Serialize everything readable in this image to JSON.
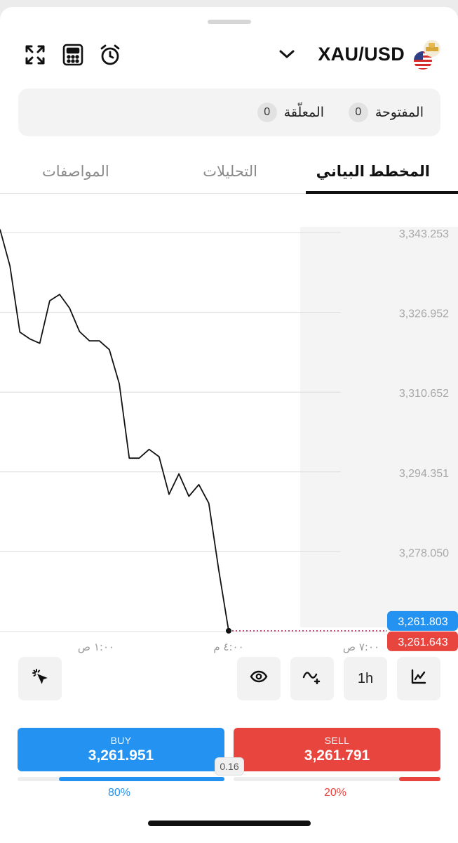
{
  "header": {
    "symbol": "XAU/USD",
    "icons": [
      "expand-icon",
      "calculator-icon",
      "alarm-icon",
      "chevron-down-icon",
      "instrument-flag-icon"
    ]
  },
  "positions": {
    "open_label": "المفتوحة",
    "open_count": "0",
    "pending_label": "المعلّقة",
    "pending_count": "0"
  },
  "tabs": {
    "chart": "المخطط البياني",
    "analysis": "التحليلات",
    "specs": "المواصفات",
    "active": "chart"
  },
  "chart_data": {
    "type": "line",
    "y_ticks": [
      "3,343.253",
      "3,326.952",
      "3,310.652",
      "3,294.351",
      "3,278.050"
    ],
    "x_ticks": [
      "١:٠٠ ص",
      "٤:٠٠ م",
      "٧:٠٠ ص"
    ],
    "ask_label": "3,261.803",
    "bid_label": "3,261.643",
    "ask_color": "#2492f0",
    "bid_color": "#e9453f",
    "ylim": [
      3261.643,
      3343.253
    ],
    "series": [
      {
        "values": [
          3343.9,
          3336.4,
          3322.9,
          3321.5,
          3320.6,
          3329.3,
          3330.6,
          3327.8,
          3323.0,
          3321.1,
          3321.1,
          3319.3,
          3312.3,
          3297.1,
          3297.1,
          3298.9,
          3297.4,
          3289.7,
          3293.9,
          3289.3,
          3291.7,
          3287.9,
          3274.3,
          3261.8
        ]
      }
    ],
    "grid": true
  },
  "toolbar": {
    "timeframe": "1h",
    "icons": [
      "chart-type-icon",
      "indicator-add-icon",
      "visibility-eye-icon",
      "cursor-select-icon"
    ]
  },
  "trade": {
    "buy_label": "BUY",
    "buy_price": "3,261.951",
    "sell_label": "SELL",
    "sell_price": "3,261.791",
    "spread": "0.16",
    "buy_pct": "80%",
    "sell_pct": "20%",
    "buy_fraction": 0.8,
    "sell_fraction": 0.2,
    "buy_color": "#2492f0",
    "sell_color": "#e9453f"
  }
}
